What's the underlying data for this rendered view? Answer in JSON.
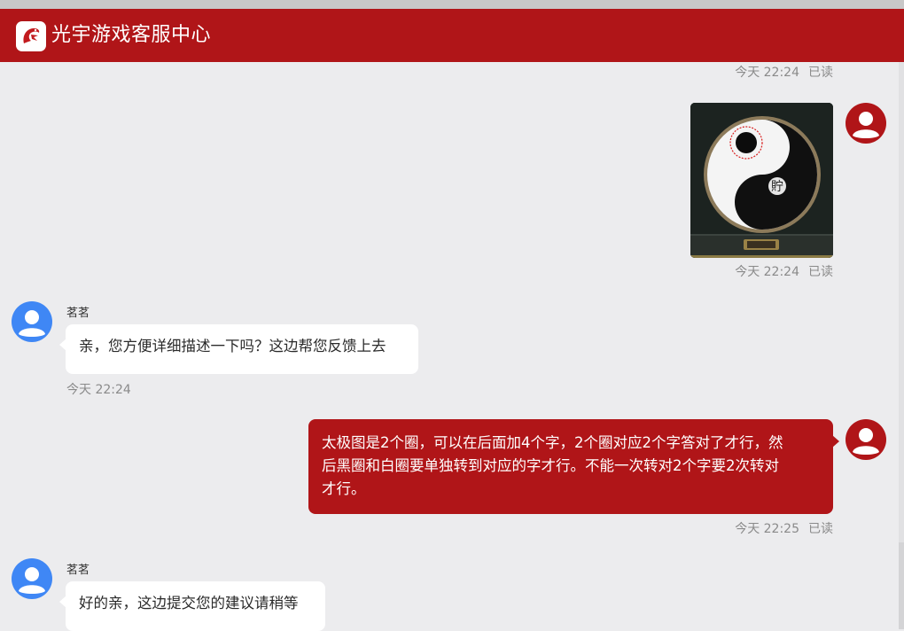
{
  "header": {
    "title": "光宇游戏客服中心"
  },
  "messages": {
    "m0": {
      "time": "今天 22:24",
      "status": "已读"
    },
    "m1": {
      "time": "今天 22:24",
      "status": "已读",
      "image_text": "貯"
    },
    "m2": {
      "sender": "茗茗",
      "text": "亲，您方便详细描述一下吗？这边帮您反馈上去",
      "time": "今天 22:24"
    },
    "m3": {
      "text_line1": "太极图是2个圈，可以在后面加4个字，2个圈对应2个字答对了才行，然",
      "text_line2": "后黑圈和白圈要单独转到对应的字才行。不能一次转对2个字要2次转对",
      "text_line3": "才行。",
      "time": "今天 22:25",
      "status": "已读"
    },
    "m4": {
      "sender": "茗茗",
      "text": "好的亲，这边提交您的建议请稍等"
    }
  },
  "colors": {
    "brand": "#b01518",
    "agent_avatar": "#3f87f5",
    "background": "#ececee"
  }
}
